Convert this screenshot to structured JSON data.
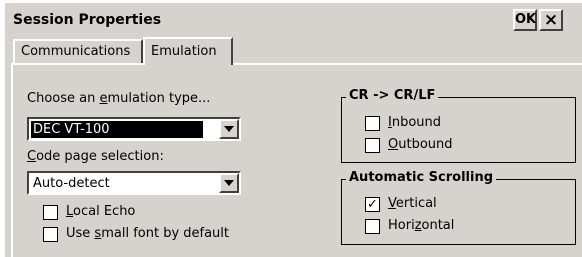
{
  "dialog": {
    "title": "Session Properties",
    "ok_label": "OK",
    "close_label": "×"
  },
  "tabs": [
    {
      "label": "Communications",
      "active": false
    },
    {
      "label": "Emulation",
      "active": true
    }
  ],
  "emulation": {
    "type_label_pre": "Choose an ",
    "type_label_acc": "e",
    "type_label_post": "mulation type...",
    "type_value": "DEC VT-100",
    "codepage_label_acc": "C",
    "codepage_label_post": "ode page selection:",
    "codepage_value": "Auto-detect",
    "local_echo": {
      "acc": "L",
      "rest": "ocal Echo",
      "checked": false
    },
    "small_font": {
      "pre": "Use ",
      "acc": "s",
      "rest": "mall font by default",
      "checked": false
    }
  },
  "crlf_group": {
    "title": "CR -> CR/LF",
    "inbound": {
      "acc": "I",
      "rest": "nbound",
      "checked": false
    },
    "outbound": {
      "acc": "O",
      "rest": "utbound",
      "checked": false
    }
  },
  "scroll_group": {
    "title": "Automatic Scrolling",
    "vertical": {
      "acc": "V",
      "rest": "ertical",
      "checked": true
    },
    "horizontal": {
      "pre": "Hori",
      "acc": "z",
      "rest": "ontal",
      "checked": false
    }
  },
  "check_mark": "✓"
}
